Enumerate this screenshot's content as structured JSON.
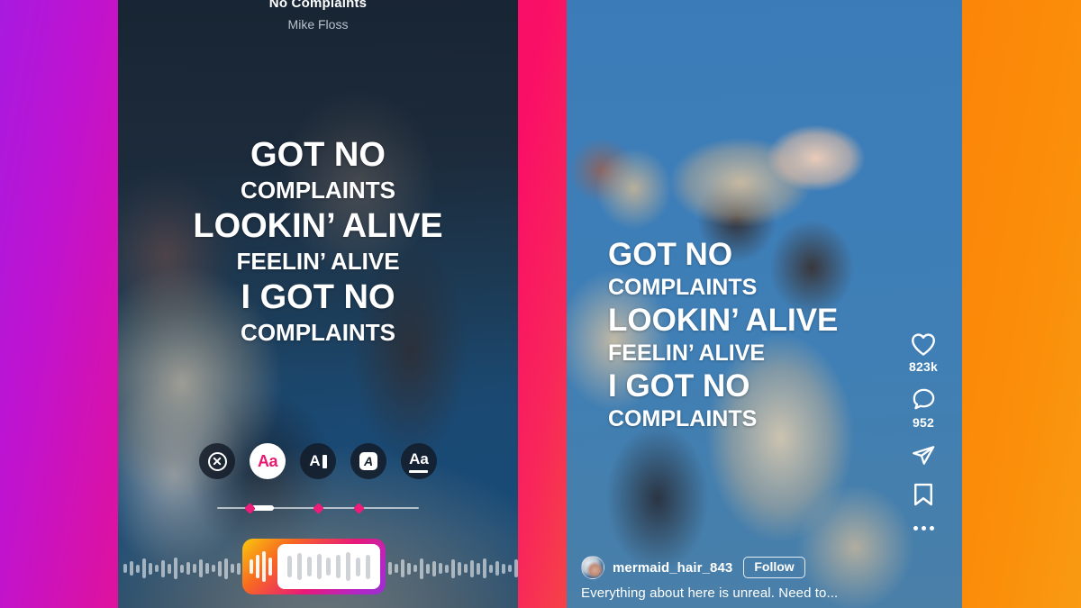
{
  "background": {
    "left_gradient": "#a81ae0 → #f60f6e",
    "right_gradient": "#f9731c → #f99a12"
  },
  "left_phone": {
    "name": "instagram-reels-lyrics-editor",
    "music": {
      "track_title": "No Complaints",
      "artist": "Mike Floss"
    },
    "lyrics": [
      {
        "text": "GOT NO",
        "size": "big"
      },
      {
        "text": "COMPLAINTS",
        "size": "small"
      },
      {
        "text": "LOOKIN’ ALIVE",
        "size": "big"
      },
      {
        "text": "FEELIN’ ALIVE",
        "size": "small"
      },
      {
        "text": "I GOT NO",
        "size": "big"
      },
      {
        "text": "COMPLAINTS",
        "size": "small"
      }
    ],
    "font_toolbar": [
      {
        "icon": "close-circle-icon",
        "label": "",
        "selected": false
      },
      {
        "icon": "font-style-aa-icon",
        "label": "Aa",
        "selected": true
      },
      {
        "icon": "font-style-a-bar-icon",
        "label": "A",
        "selected": false
      },
      {
        "icon": "font-style-a-box-icon",
        "label": "A",
        "selected": false
      },
      {
        "icon": "font-style-aa-underline-icon",
        "label": "Aa",
        "selected": false
      }
    ],
    "timeline": {
      "handle_left_pct": 17,
      "handle_width_pct": 11,
      "markers_pct": [
        16,
        50,
        70
      ],
      "accent": "#ec1c78"
    },
    "audio_trimmer": {
      "selection_start_pct": 31,
      "selection_width_pct": 36,
      "gradient": "#f9c80e → #9a2fd0"
    }
  },
  "right_phone": {
    "name": "instagram-reel-playback",
    "lyrics": [
      {
        "text": "GOT NO",
        "size": "big"
      },
      {
        "text": "COMPLAINTS",
        "size": "small"
      },
      {
        "text": "LOOKIN’ ALIVE",
        "size": "big"
      },
      {
        "text": "FEELIN’ ALIVE",
        "size": "small"
      },
      {
        "text": "I GOT NO",
        "size": "big"
      },
      {
        "text": "COMPLAINTS",
        "size": "small"
      }
    ],
    "actions": {
      "like_icon": "heart-icon",
      "like_count": "823k",
      "comment_icon": "comment-icon",
      "comment_count": "952",
      "share_icon": "share-paper-plane-icon",
      "save_icon": "bookmark-icon",
      "more_icon": "more-options-icon"
    },
    "post": {
      "username": "mermaid_hair_843",
      "follow_label": "Follow",
      "caption": "Everything about here is unreal. Need to..."
    }
  }
}
